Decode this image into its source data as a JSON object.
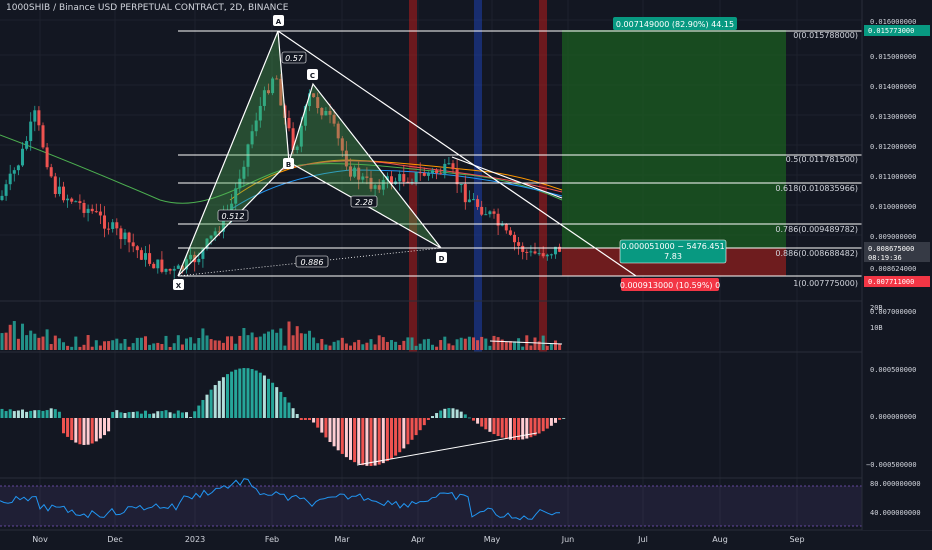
{
  "title": "1000SHIB / Binance USD PERPETUAL CONTRACT, 2D, BINANCE",
  "price_axis": {
    "labels": [
      "0.016000000",
      "0.015000000",
      "0.014000000",
      "0.013000000",
      "0.012000000",
      "0.011000000",
      "0.010000000",
      "0.009000000",
      "0.008624000"
    ],
    "tag_target": "0.015773000",
    "tag_last": "0.008675000",
    "tag_timer": "08:19:36",
    "tag_stop": "0.007711000",
    "tag_bottom": "0.007000000"
  },
  "volume_axis": {
    "labels": [
      "20B",
      "10B"
    ]
  },
  "macd_axis": {
    "labels": [
      "0.000500000",
      "0.000000000",
      "−0.000500000"
    ]
  },
  "rsi_axis": {
    "labels": [
      "80.000000000",
      "40.000000000"
    ]
  },
  "time_axis": [
    "Nov",
    "Dec",
    "2023",
    "Feb",
    "Mar",
    "Apr",
    "May",
    "Jun",
    "Jul",
    "Aug",
    "Sep"
  ],
  "fib_levels": [
    {
      "label": "0(0.015788000)",
      "price": 0.015788
    },
    {
      "label": "0.5(0.011781500)",
      "price": 0.0117815
    },
    {
      "label": "0.618(0.010835966)",
      "price": 0.010835966
    },
    {
      "label": "0.786(0.009489782)",
      "price": 0.009489782
    },
    {
      "label": "0.886(0.008688482)",
      "price": 0.008688482
    },
    {
      "label": "1(0.007775000)",
      "price": 0.007775
    }
  ],
  "pattern_points": [
    "X",
    "A",
    "B",
    "C",
    "D"
  ],
  "pattern_ratios": [
    "0.57",
    "0.512",
    "2.28",
    "0.886"
  ],
  "position": {
    "target_label": "0.007149000 (82.90%) 44.15",
    "entry_label_1": "0.000051000 − 5476.451",
    "entry_label_2": "7.83",
    "stop_label": "0.000913000 (10.59%) 0"
  },
  "colors": {
    "background": "#131722",
    "up": "#26a69a",
    "down": "#ef5350",
    "profit_zone": "#1b5e20",
    "loss_zone": "#7f1d1d",
    "rsi_line": "#2196f3",
    "rsi_band": "#7e57c2"
  }
}
